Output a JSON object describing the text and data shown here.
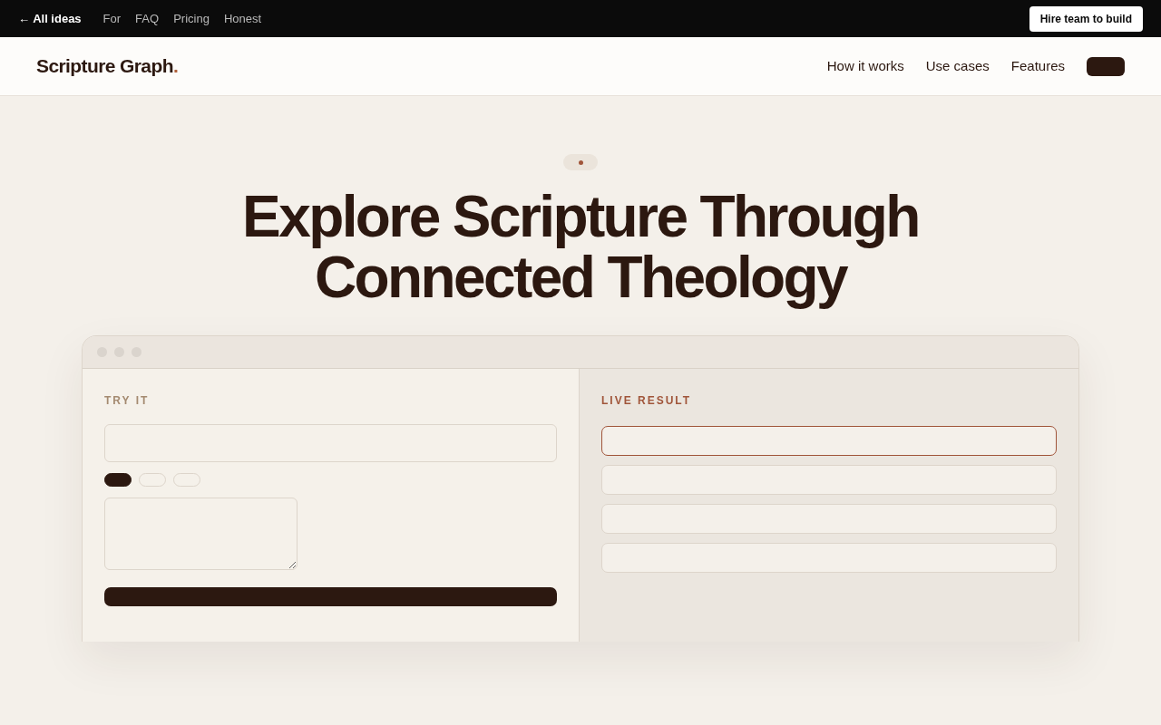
{
  "top_bar": {
    "back_link": "← All ideas",
    "links": [
      "For",
      "FAQ",
      "Pricing",
      "Honest"
    ],
    "cta": "Hire team to build"
  },
  "navbar": {
    "brand": "Scripture Graph",
    "brand_dot": ".",
    "links": [
      "How it works",
      "Use cases",
      "Features"
    ]
  },
  "hero": {
    "headline": [
      "Explore Scripture Through",
      "Connected Theology"
    ]
  },
  "demo": {
    "left": {
      "label": "TRY IT",
      "chips": [
        {
          "selected": true
        },
        {
          "selected": false
        },
        {
          "selected": false
        }
      ]
    },
    "right": {
      "label": "LIVE RESULT",
      "results": [
        {
          "selected": true
        },
        {
          "selected": false
        },
        {
          "selected": false
        },
        {
          "selected": false
        }
      ]
    }
  }
}
